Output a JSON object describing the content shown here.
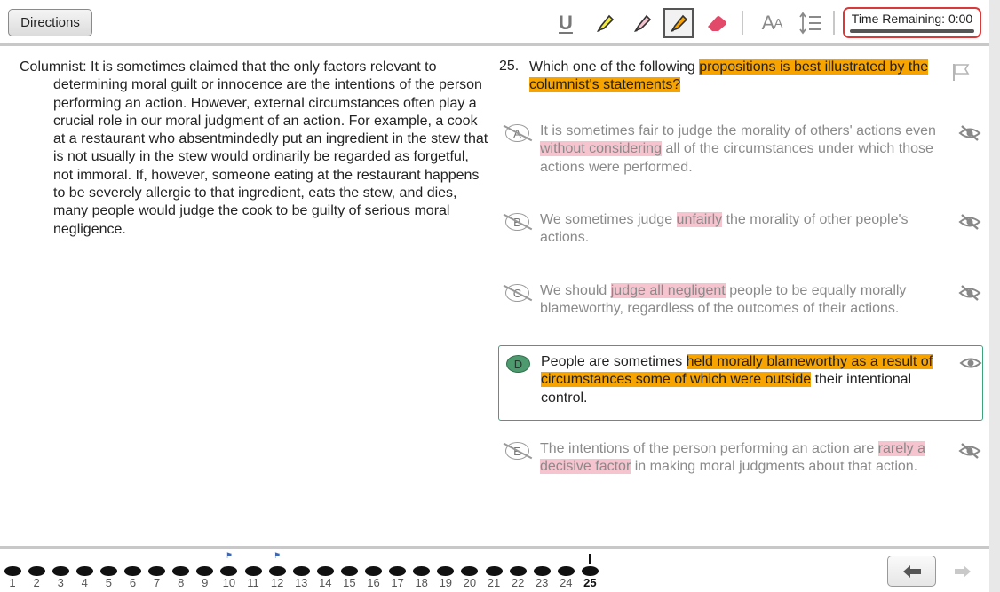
{
  "toolbar": {
    "directions_label": "Directions",
    "underline_label": "U",
    "font_size_label": "A",
    "font_size_small": "A",
    "timer_label": "Time Remaining: 0:00"
  },
  "passage": {
    "text": "Columnist: It is sometimes claimed that the only factors relevant to determining moral guilt or innocence are the intentions of the person performing an action. However, external circumstances often play a crucial role in our moral judgment of an action. For example, a cook at a restaurant who absentmindedly put an ingredient in the stew that is not usually in the stew would ordinarily be regarded as forgetful, not immoral. If, however, someone eating at the restaurant happens to be severely allergic to that ingredient, eats the stew, and dies, many people would judge the cook to be guilty of serious moral negligence."
  },
  "question": {
    "number": "25.",
    "stem_pre": "Which one of the following ",
    "stem_highlight": "propositions is best illustrated by the columnist's statements?",
    "choices": [
      {
        "letter": "A",
        "pre": "It is sometimes fair to judge the morality of others' actions even ",
        "hl": "without considering",
        "post": " all of the circumstances under which those actions were performed.",
        "state": "eliminated"
      },
      {
        "letter": "B",
        "pre": "We sometimes judge ",
        "hl": "unfairly",
        "post": " the morality of other people's actions.",
        "state": "eliminated"
      },
      {
        "letter": "C",
        "pre": "We should ",
        "hl": "judge all negligent",
        "post": " people to be equally morally blameworthy, regardless of the outcomes of their actions.",
        "state": "eliminated"
      },
      {
        "letter": "D",
        "pre": "People are sometimes ",
        "hl": "held morally blameworthy as a result of circumstances some of which were outside",
        "post": " their intentional control.",
        "state": "selected"
      },
      {
        "letter": "E",
        "pre": "The intentions of the person performing an action are ",
        "hl": "rarely a decisive factor",
        "post": " in making moral judgments about that action.",
        "state": "eliminated"
      }
    ]
  },
  "nav": {
    "questions": [
      "1",
      "2",
      "3",
      "4",
      "5",
      "6",
      "7",
      "8",
      "9",
      "10",
      "11",
      "12",
      "13",
      "14",
      "15",
      "16",
      "17",
      "18",
      "19",
      "20",
      "21",
      "22",
      "23",
      "24",
      "25"
    ],
    "flagged": [
      "10",
      "12"
    ],
    "current": "25"
  },
  "colors": {
    "highlight_orange": "#f7a400",
    "highlight_pink": "#f6c4cf",
    "selected_green": "#3ca37a",
    "timer_red": "#d83a3a"
  }
}
